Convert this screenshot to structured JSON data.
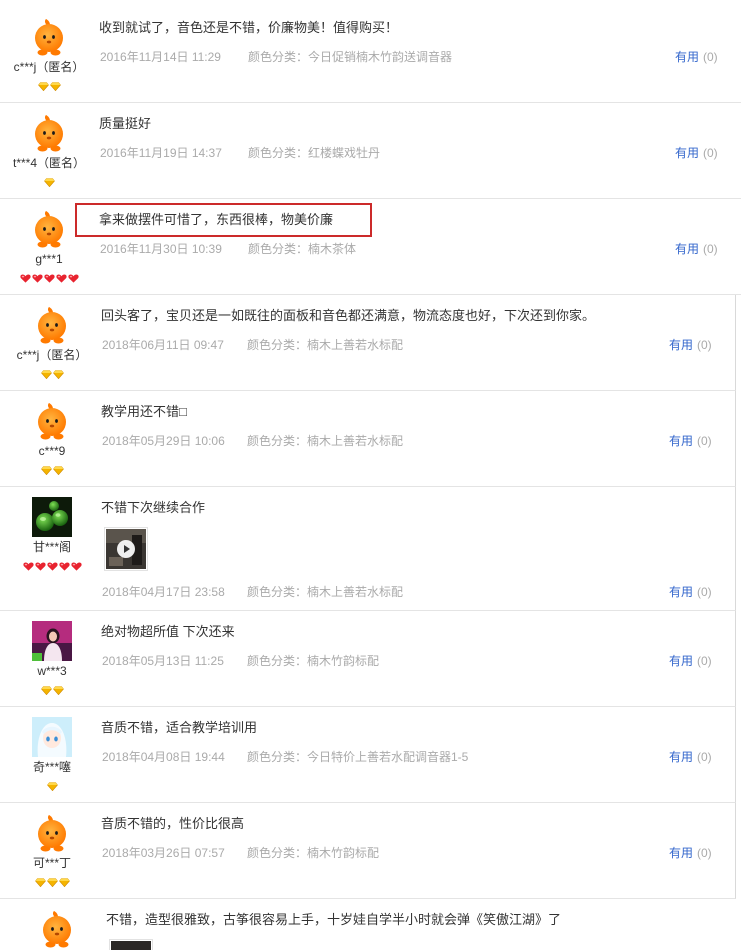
{
  "colors": {
    "comment_text": "#333333",
    "meta_text": "#aaaaaa",
    "useful_link": "#3366cc",
    "highlight_border": "#cc2a2a",
    "divider": "#e4e4e4",
    "panel_border": "#d9d9d9"
  },
  "useful_label": "有用",
  "reviews": [
    {
      "user": "c***j（匿名）",
      "avatar": "mascot-avatar",
      "badge": "yellow-diamond",
      "badge_count": 2,
      "comment": "收到就试了，音色还是不错，价廉物美！值得购买！",
      "date": "2016年11月14日 11:29",
      "sku": "颜色分类：今日促销楠木竹韵送调音器",
      "useful_count": "(0)"
    },
    {
      "user": "t***4（匿名）",
      "avatar": "mascot-avatar",
      "badge": "yellow-diamond",
      "badge_count": 1,
      "comment": "质量挺好",
      "date": "2016年11月19日 14:37",
      "sku": "颜色分类：红楼蝶戏牡丹",
      "useful_count": "(0)"
    },
    {
      "user": "g***1",
      "avatar": "mascot-avatar",
      "badge": "red-heart",
      "badge_count": 5,
      "comment": "拿来做摆件可惜了，东西很棒，物美价廉",
      "highlighted": true,
      "date": "2016年11月30日 10:39",
      "sku": "颜色分类：楠木茶体",
      "useful_count": "(0)"
    },
    {
      "user": "c***j（匿名）",
      "avatar": "mascot-avatar",
      "badge": "yellow-diamond",
      "badge_count": 2,
      "comment": "回头客了，宝贝还是一如既往的面板和音色都还满意，物流态度也好，下次还到你家。",
      "date": "2018年06月11日 09:47",
      "sku": "颜色分类：楠木上善若水标配",
      "useful_count": "(0)"
    },
    {
      "user": "c***9",
      "avatar": "mascot-avatar",
      "badge": "yellow-diamond",
      "badge_count": 2,
      "comment": "教学用还不错□",
      "date": "2018年05月29日 10:06",
      "sku": "颜色分类：楠木上善若水标配",
      "useful_count": "(0)"
    },
    {
      "user": "甘***阁",
      "avatar": "green-avatar",
      "badge": "red-heart",
      "badge_count": 5,
      "comment": "不错下次继续合作",
      "media": "video",
      "date": "2018年04月17日 23:58",
      "sku": "颜色分类：楠木上善若水标配",
      "useful_count": "(0)"
    },
    {
      "user": "w***3",
      "avatar": "pink-avatar",
      "badge": "yellow-diamond",
      "badge_count": 2,
      "comment": "绝对物超所值 下次还来",
      "date": "2018年05月13日 11:25",
      "sku": "颜色分类：楠木竹韵标配",
      "useful_count": "(0)"
    },
    {
      "user": "奇***噻",
      "avatar": "anime-avatar",
      "badge": "yellow-diamond",
      "badge_count": 1,
      "comment": "音质不错，适合教学培训用",
      "date": "2018年04月08日 19:44",
      "sku": "颜色分类：今日特价上善若水配调音器1-5",
      "useful_count": "(0)"
    },
    {
      "user": "可***丁",
      "avatar": "mascot-avatar",
      "badge": "yellow-diamond",
      "badge_count": 3,
      "comment": "音质不错的，性价比很高",
      "date": "2018年03月26日 07:57",
      "sku": "颜色分类：楠木竹韵标配",
      "useful_count": "(0)"
    },
    {
      "avatar": "mascot-avatar",
      "comment": "不错，造型很雅致，古筝很容易上手，十岁娃自学半小时就会弹《笑傲江湖》了",
      "media": "photo"
    }
  ]
}
